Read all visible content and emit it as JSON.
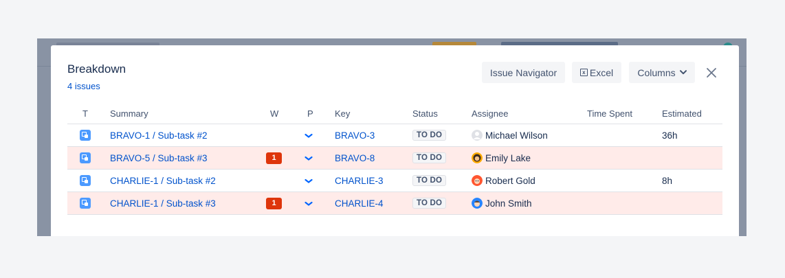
{
  "modal": {
    "title": "Breakdown",
    "issue_count": "4 issues",
    "buttons": {
      "issue_navigator": "Issue Navigator",
      "excel": "Excel",
      "columns": "Columns"
    }
  },
  "table": {
    "headers": {
      "type": "T",
      "summary": "Summary",
      "w": "W",
      "p": "P",
      "key": "Key",
      "status": "Status",
      "assignee": "Assignee",
      "time_spent": "Time Spent",
      "estimated": "Estimated"
    },
    "rows": [
      {
        "summary": "BRAVO-1 /  Sub-task #2",
        "w": "",
        "key": "BRAVO-3",
        "status": "TO DO",
        "assignee": "Michael Wilson",
        "time_spent": "",
        "estimated": "36h",
        "highlight": false,
        "avatar": "grey-person-avatar",
        "priority_icon": "low-priority-icon"
      },
      {
        "summary": "BRAVO-5 /  Sub-task #3",
        "w": "1",
        "key": "BRAVO-8",
        "status": "TO DO",
        "assignee": "Emily Lake",
        "time_spent": "",
        "estimated": "",
        "highlight": true,
        "avatar": "dark-hair-avatar",
        "priority_icon": "low-priority-icon"
      },
      {
        "summary": "CHARLIE-1 /  Sub-task #2",
        "w": "",
        "key": "CHARLIE-3",
        "status": "TO DO",
        "assignee": "Robert Gold",
        "time_spent": "",
        "estimated": "8h",
        "highlight": false,
        "avatar": "red-avatar",
        "priority_icon": "low-priority-icon"
      },
      {
        "summary": "CHARLIE-1 /  Sub-task #3",
        "w": "1",
        "key": "CHARLIE-4",
        "status": "TO DO",
        "assignee": "John Smith",
        "time_spent": "",
        "estimated": "",
        "highlight": true,
        "avatar": "blue-avatar",
        "priority_icon": "low-priority-icon"
      }
    ]
  },
  "colors": {
    "link": "#0052cc",
    "highlight_row": "#ffebe9",
    "w_badge": "#de350b",
    "type_icon": "#4c9aff"
  }
}
